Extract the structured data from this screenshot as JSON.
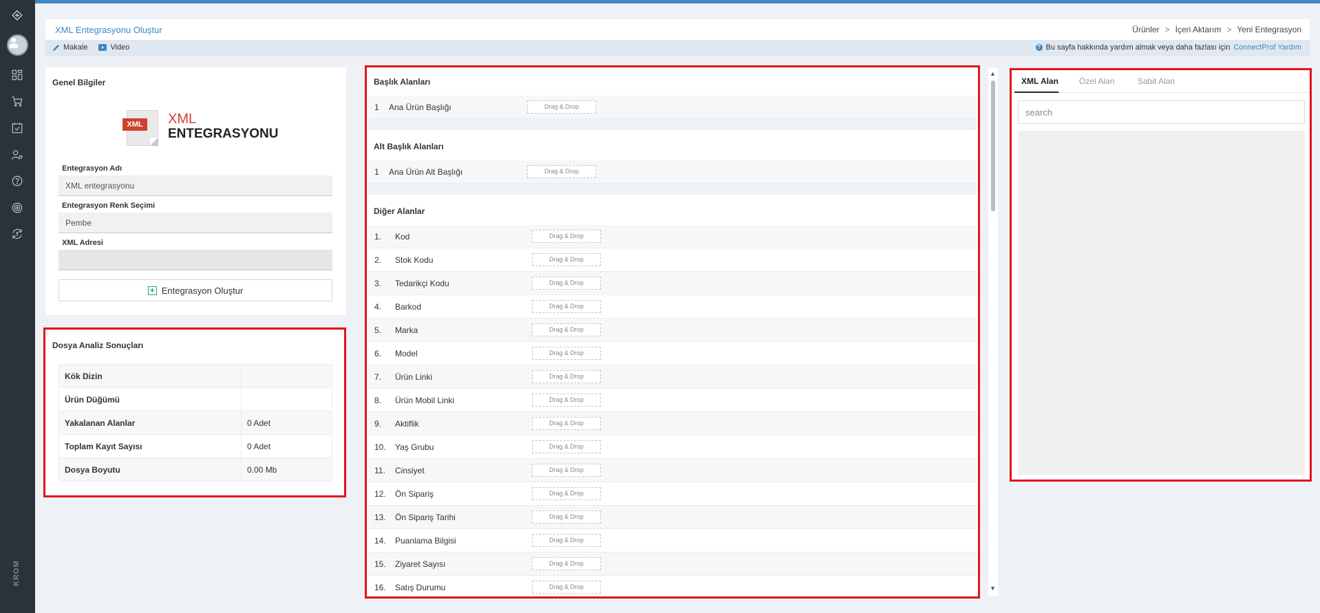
{
  "sidebar": {
    "brand": "KROM",
    "icons": [
      "logo-icon",
      "dashboard-icon",
      "cart-icon",
      "checklist-icon",
      "users-settings-icon",
      "help-icon",
      "radar-icon",
      "sync-money-icon"
    ]
  },
  "header": {
    "title": "XML Entegrasyonu Oluştur",
    "breadcrumb": [
      "Ürünler",
      "İçeri Aktarım",
      "Yeni Entegrasyon"
    ]
  },
  "subbar": {
    "article_label": "Makale",
    "video_label": "Video",
    "help_text": "Bu sayfa hakkında yardım almak veya daha fazlası için",
    "help_link": "ConnectProf Yardım"
  },
  "general": {
    "title": "Genel Bilgiler",
    "logo_tag": "XML",
    "logo_line1": "XML",
    "logo_line2": "ENTEGRASYONU",
    "name_label": "Entegrasyon Adı",
    "name_value": "XML entegrasyonu",
    "color_label": "Entegrasyon Renk Seçimi",
    "color_value": "Pembe",
    "url_label": "XML Adresi",
    "url_value": "",
    "create_button": "Entegrasyon Oluştur"
  },
  "analysis": {
    "title": "Dosya Analiz Sonuçları",
    "rows": [
      {
        "key": "Kök Dizin",
        "value": ""
      },
      {
        "key": "Ürün Düğümü",
        "value": ""
      },
      {
        "key": "Yakalanan Alanlar",
        "value": "0 Adet"
      },
      {
        "key": "Toplam Kayıt Sayısı",
        "value": "0 Adet"
      },
      {
        "key": "Dosya Boyutu",
        "value": "0.00 Mb"
      }
    ]
  },
  "mapping": {
    "drag_drop": "Drag & Drop",
    "title_section": {
      "title": "Başlık Alanları",
      "rows": [
        {
          "num": "1",
          "name": "Ana Ürün Başlığı"
        }
      ]
    },
    "subtitle_section": {
      "title": "Alt Başlık Alanları",
      "rows": [
        {
          "num": "1",
          "name": "Ana Ürün Alt Başlığı"
        }
      ]
    },
    "other_section": {
      "title": "Diğer Alanlar",
      "rows": [
        {
          "num": "1.",
          "name": "Kod"
        },
        {
          "num": "2.",
          "name": "Stok Kodu"
        },
        {
          "num": "3.",
          "name": "Tedarikçi Kodu"
        },
        {
          "num": "4.",
          "name": "Barkod"
        },
        {
          "num": "5.",
          "name": "Marka"
        },
        {
          "num": "6.",
          "name": "Model"
        },
        {
          "num": "7.",
          "name": "Ürün Linki"
        },
        {
          "num": "8.",
          "name": "Ürün Mobil Linki"
        },
        {
          "num": "9.",
          "name": "Aktiflik"
        },
        {
          "num": "10.",
          "name": "Yaş Grubu"
        },
        {
          "num": "11.",
          "name": "Cinsiyet"
        },
        {
          "num": "12.",
          "name": "Ön Sipariş"
        },
        {
          "num": "13.",
          "name": "Ön Sipariş Tarihi"
        },
        {
          "num": "14.",
          "name": "Puanlama Bilgisi"
        },
        {
          "num": "15.",
          "name": "Ziyaret Sayısı"
        },
        {
          "num": "16.",
          "name": "Satış Durumu"
        }
      ]
    }
  },
  "fields_panel": {
    "tabs": [
      "XML Alan",
      "Özel Alan",
      "Sabit Alan"
    ],
    "active_tab": "XML Alan",
    "search_placeholder": "search"
  },
  "colors": {
    "accent": "#3e87c4",
    "highlight": "#e3121b",
    "sidebar": "#2b3338"
  }
}
